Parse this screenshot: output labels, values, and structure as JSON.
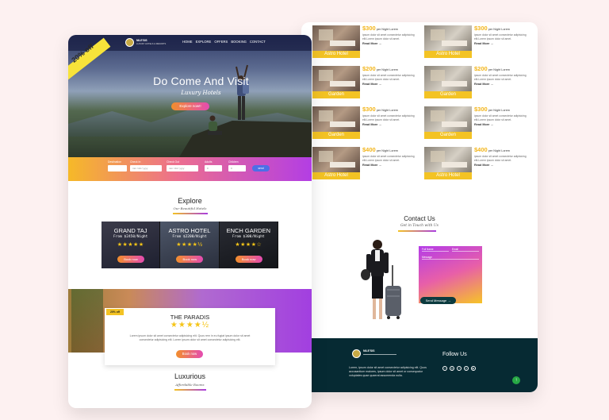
{
  "colors": {
    "background": "#fdf1f1",
    "accent_yellow": "#f3c324",
    "accent_purple": "#a83ce0",
    "footer": "#062a33"
  },
  "nav": {
    "brand": "NILE'SIS",
    "brand_sub": "LUXURY HOTELS & RESORTS",
    "menu": [
      "HOME",
      "EXPLORE",
      "OFFERS",
      "BOOKING",
      "CONTACT"
    ]
  },
  "hero": {
    "offer": "20% off",
    "title": "Do Come And Visit",
    "subtitle": "Luxury Hotels",
    "button": "Explore now!!"
  },
  "search": {
    "fields": [
      {
        "label": "Destination",
        "value": ""
      },
      {
        "label": "Check In",
        "value": "mm / dd / yyyy"
      },
      {
        "label": "Check Out",
        "value": "mm / dd / yyyy"
      },
      {
        "label": "Adults",
        "value": "0"
      },
      {
        "label": "Children",
        "value": "0"
      }
    ],
    "button": "send"
  },
  "explore": {
    "title": "Explore",
    "subtitle": "Our Beautiful Hotels",
    "hotels": [
      {
        "name": "GRAND TAJ",
        "price": "From $2450/Night",
        "stars": "★★★★★",
        "button": "Book now"
      },
      {
        "name": "ASTRO HOTEL",
        "price": "From $2200/Night",
        "stars": "★★★★½",
        "button": "Book now"
      },
      {
        "name": "ENCH GARDEN",
        "price": "From $300/Night",
        "stars": "★★★★☆",
        "button": "Book now"
      }
    ]
  },
  "promo": {
    "tag": "20% off",
    "title": "THE PARADIS",
    "stars": "★★★★½",
    "text": "Lorem ipsum dolor sit amet consectetur adipisicing elit. Quos rem in eu fugiat ipsum dolor sit amet consectetur adipisicing elit. Lorem ipsum dolor sit amet consectetur adipisicing elit.",
    "button": "Book now"
  },
  "luxurious": {
    "title": "Luxurious",
    "subtitle": "Affordable Rooms"
  },
  "rooms": [
    {
      "price": "$300",
      "per": "per Night Lorem",
      "tag": "Astro Hotel",
      "desc": "ipsum dolor sit amet consectetur adipisicing elit.Lorem ipsum dolor sit amet.",
      "more": "Read More →"
    },
    {
      "price": "$300",
      "per": "per Night Lorem",
      "tag": "Astro Hotel",
      "desc": "ipsum dolor sit amet consectetur adipisicing elit.Lorem ipsum dolor sit amet.",
      "more": "Read More →"
    },
    {
      "price": "$200",
      "per": "per Night Lorem",
      "tag": "Garden",
      "desc": "ipsum dolor sit amet consectetur adipisicing elit.Lorem ipsum dolor sit amet.",
      "more": "Read More →"
    },
    {
      "price": "$200",
      "per": "per Night Lorem",
      "tag": "Garden",
      "desc": "ipsum dolor sit amet consectetur adipisicing elit.Lorem ipsum dolor sit amet.",
      "more": "Read More →"
    },
    {
      "price": "$300",
      "per": "per Night Lorem",
      "tag": "Garden",
      "desc": "ipsum dolor sit amet consectetur adipisicing elit.Lorem ipsum dolor sit amet.",
      "more": "Read More →"
    },
    {
      "price": "$300",
      "per": "per Night Lorem",
      "tag": "Garden",
      "desc": "ipsum dolor sit amet consectetur adipisicing elit.Lorem ipsum dolor sit amet.",
      "more": "Read More →"
    },
    {
      "price": "$400",
      "per": "per Night Lorem",
      "tag": "Astro Hotel",
      "desc": "ipsum dolor sit amet consectetur adipisicing elit.Lorem ipsum dolor sit amet.",
      "more": "Read More →"
    },
    {
      "price": "$400",
      "per": "per Night Lorem",
      "tag": "Astro Hotel",
      "desc": "ipsum dolor sit amet consectetur adipisicing elit.Lorem ipsum dolor sit amet.",
      "more": "Read More →"
    }
  ],
  "contact": {
    "title": "Contact Us",
    "subtitle": "Get in Touch with Us",
    "fields": [
      "Full Name",
      "Email",
      "Message"
    ],
    "button": "Send Message →"
  },
  "footer": {
    "brand": "NILE'SIS",
    "brand_sub": "LUXURY HOTELS",
    "text": "Lorem, ipsum dolor sit amet consectetur adipisicing elit. Quos accusantium maiores, ipsum dolor sit amet or consequatur voluptates quae quaerat assumenda nulla.",
    "follow": "Follow Us",
    "social_icons": [
      "twitter-icon",
      "instagram-icon",
      "facebook-icon",
      "pinterest-icon",
      "youtube-icon"
    ],
    "social_glyphs": [
      "t",
      "◎",
      "f",
      "p",
      "▶"
    ],
    "to_top": "↑"
  }
}
